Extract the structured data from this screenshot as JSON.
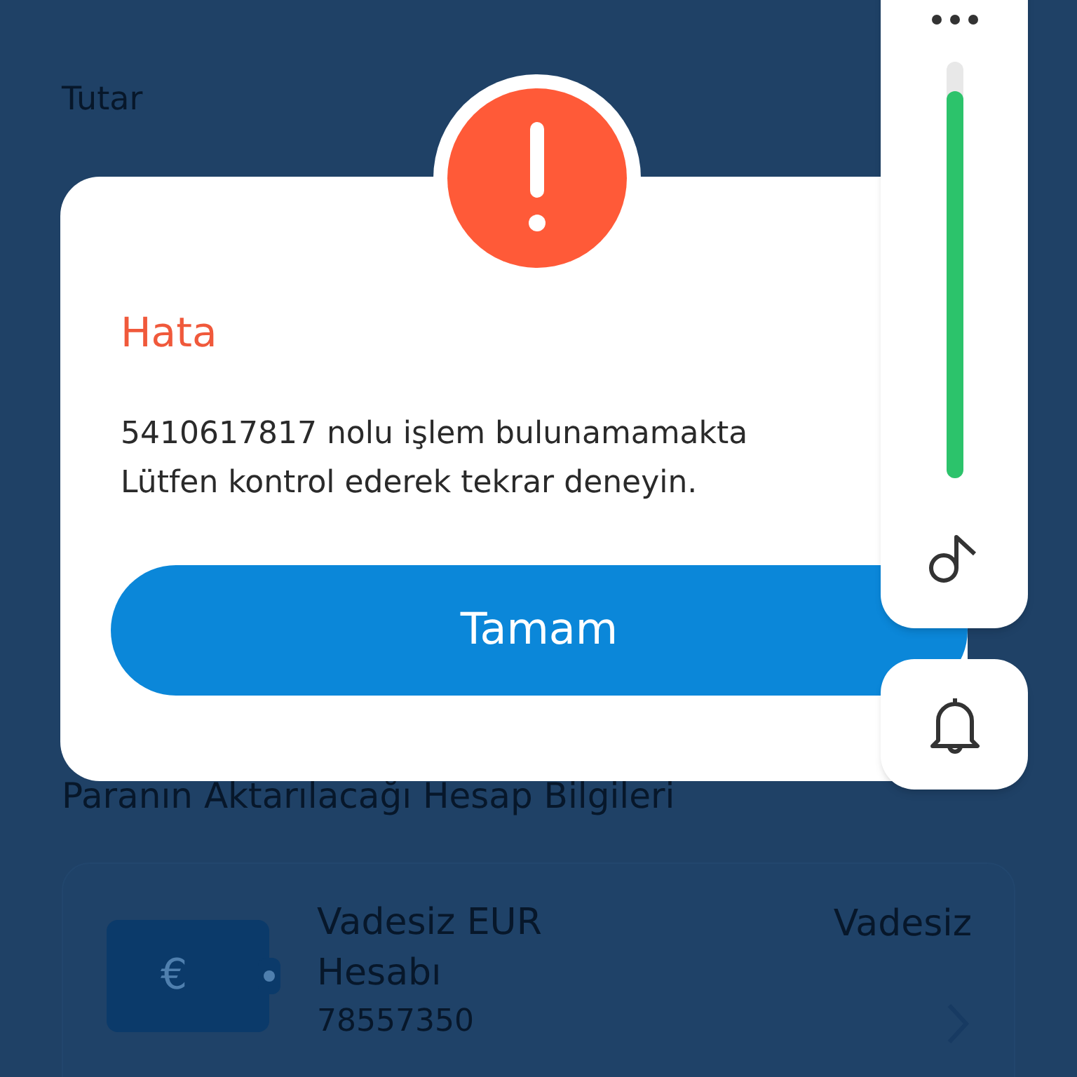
{
  "background": {
    "amount_label": "Tutar",
    "section_title": "Paranın Aktarılacağı Hesap Bilgileri",
    "account": {
      "currency_symbol": "€",
      "name": "Vadesiz EUR Hesabı",
      "number": "78557350",
      "type": "Vadesiz"
    }
  },
  "dialog": {
    "title": "Hata",
    "message_lines": [
      "5410617817 nolu işlem bulunamamakta",
      "Lütfen kontrol ederek tekrar deneyin."
    ],
    "button": "Tamam"
  },
  "volume_panel": {
    "level": 0.93
  }
}
